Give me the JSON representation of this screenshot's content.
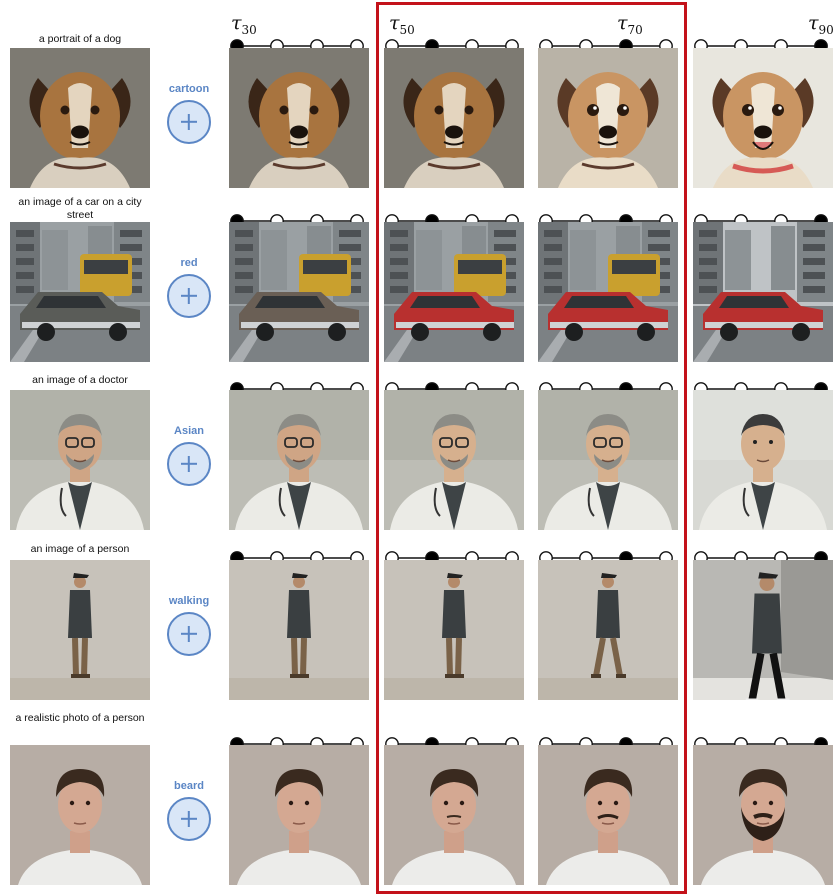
{
  "column_headers": [
    {
      "symbol": "τ",
      "sub": "30"
    },
    {
      "symbol": "τ",
      "sub": "50"
    },
    {
      "symbol": "τ",
      "sub": "70"
    },
    {
      "symbol": "τ",
      "sub": "90"
    }
  ],
  "rows": [
    {
      "prompt": "a portrait of a dog",
      "edit": "cartoon",
      "subject": "dog"
    },
    {
      "prompt": "an image of a car on a city street",
      "edit": "red",
      "subject": "car"
    },
    {
      "prompt": "an image of a doctor",
      "edit": "Asian",
      "subject": "doctor"
    },
    {
      "prompt": "an image of a person",
      "edit": "walking",
      "subject": "walker"
    },
    {
      "prompt": "a realistic photo of a person",
      "edit": "beard",
      "subject": "portrait"
    }
  ],
  "schedule_active_index": [
    0,
    1,
    2,
    3
  ],
  "colors": {
    "accent": "#5b86c5",
    "highlight_frame": "#c3121a"
  }
}
